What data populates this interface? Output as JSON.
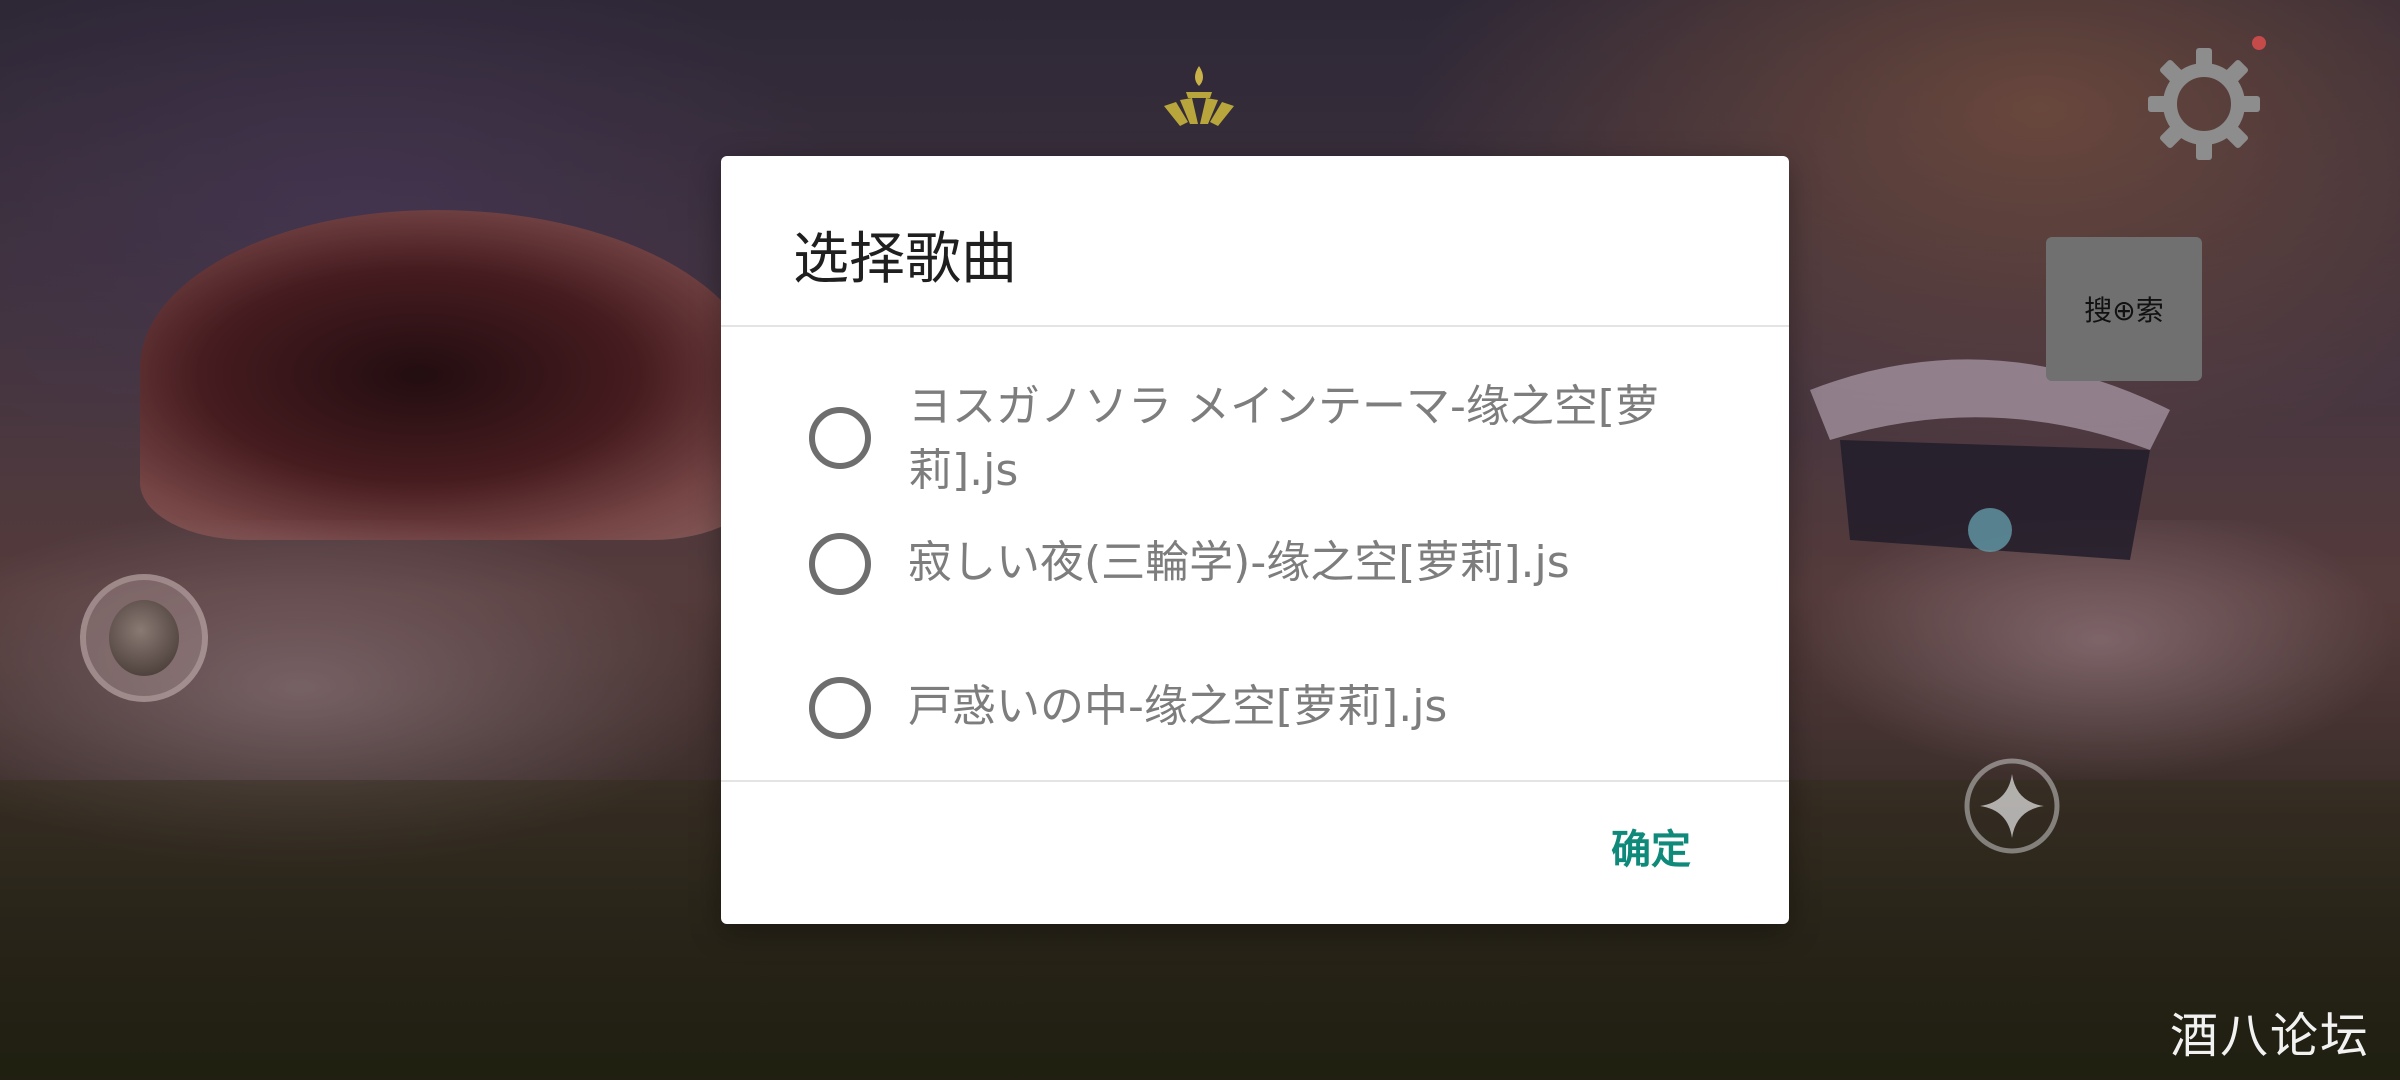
{
  "dialog": {
    "title": "选择歌曲",
    "items": [
      {
        "label": "ヨスガノソラ メインテーマ-缘之空[萝莉].js",
        "selected": false
      },
      {
        "label": "寂しい夜(三輪学)-缘之空[萝莉].js",
        "selected": false
      },
      {
        "label": "戸惑いの中-缘之空[萝莉].js",
        "selected": false
      }
    ],
    "confirm_label": "确定"
  },
  "hud": {
    "search_label": "搜⊕索",
    "icons": [
      "candle-icon",
      "settings-gear-icon",
      "emote-icon",
      "star-icon"
    ]
  },
  "watermark": "酒八论坛",
  "colors": {
    "accent": "#0f8a7a",
    "dialog_bg": "#ffffff",
    "radio": "#6e6e6e",
    "item_text": "#7d7d7d"
  }
}
